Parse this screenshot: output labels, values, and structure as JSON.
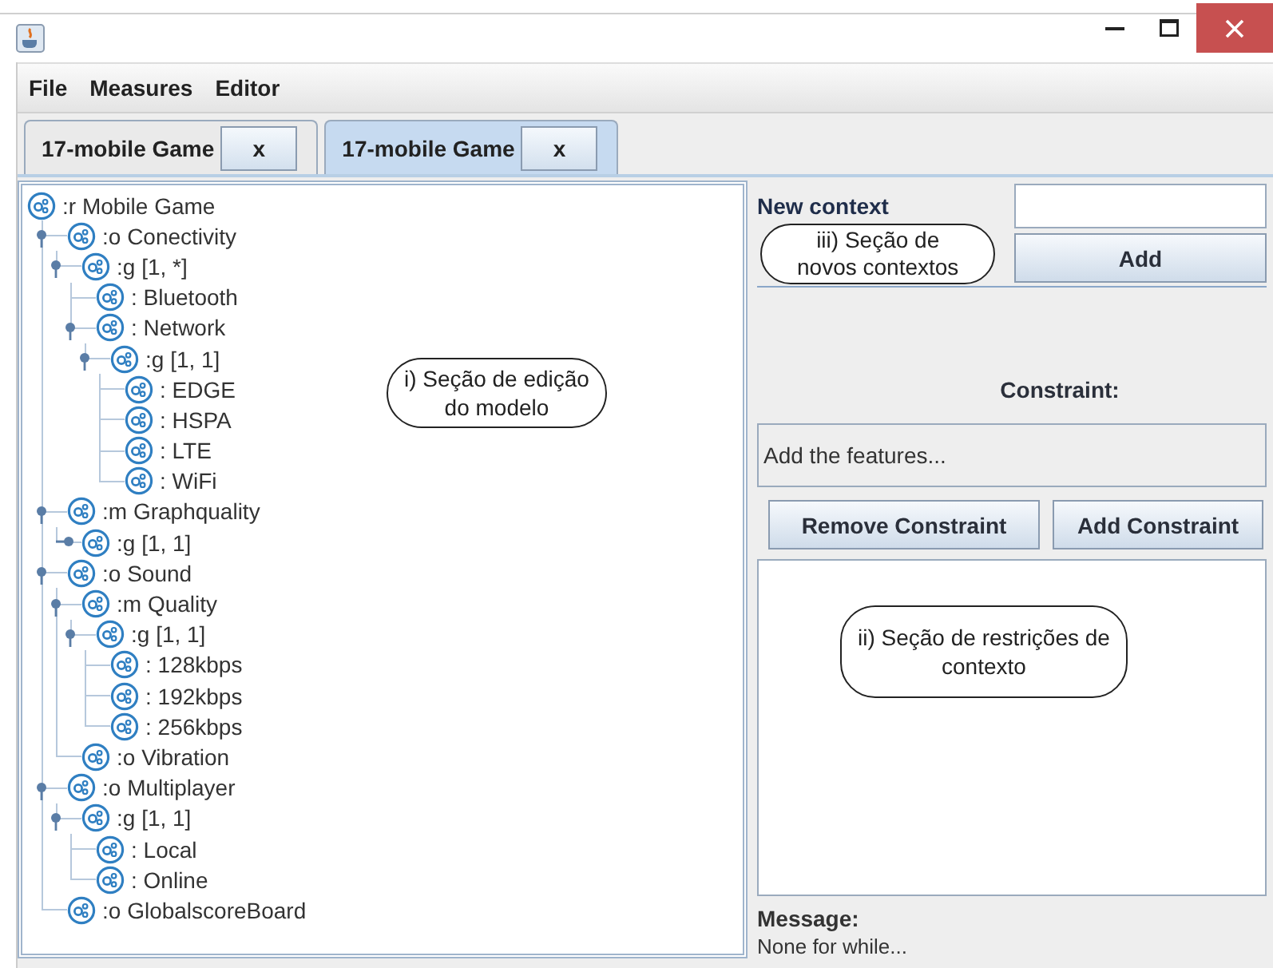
{
  "menu": [
    "File",
    "Measures",
    "Editor"
  ],
  "tabs": [
    {
      "label": "17-mobile Game",
      "close": "x",
      "selected": false
    },
    {
      "label": "17-mobile Game",
      "close": "x",
      "selected": true
    }
  ],
  "tree": {
    "label": ":r Mobile Game",
    "children": [
      {
        "label": ":o Conectivity",
        "expanded": true,
        "children": [
          {
            "label": ":g [1, *]",
            "expanded": true,
            "children": [
              {
                "label": ": Bluetooth"
              },
              {
                "label": ": Network",
                "expanded": true,
                "children": [
                  {
                    "label": ":g [1, 1]",
                    "expanded": true,
                    "children": [
                      {
                        "label": ": EDGE"
                      },
                      {
                        "label": ": HSPA"
                      },
                      {
                        "label": ": LTE"
                      },
                      {
                        "label": ": WiFi"
                      }
                    ]
                  }
                ]
              }
            ]
          }
        ]
      },
      {
        "label": ":m Graphquality",
        "expanded": true,
        "children": [
          {
            "label": ":g [1, 1]",
            "expanded": false
          }
        ]
      },
      {
        "label": ":o Sound",
        "expanded": true,
        "children": [
          {
            "label": ":m Quality",
            "expanded": true,
            "children": [
              {
                "label": ":g [1, 1]",
                "expanded": true,
                "children": [
                  {
                    "label": ": 128kbps"
                  },
                  {
                    "label": ": 192kbps"
                  },
                  {
                    "label": ": 256kbps"
                  }
                ]
              }
            ]
          },
          {
            "label": ":o Vibration"
          }
        ]
      },
      {
        "label": ":o Multiplayer",
        "expanded": true,
        "children": [
          {
            "label": ":g [1, 1]",
            "expanded": true,
            "children": [
              {
                "label": ": Local"
              },
              {
                "label": ": Online"
              }
            ]
          }
        ]
      },
      {
        "label": ":o GlobalscoreBoard"
      }
    ]
  },
  "tree_callout": [
    "i) Seção de edição",
    "do modelo"
  ],
  "context": {
    "label": "New context",
    "button": "Add",
    "callout": [
      "iii) Seção de",
      "novos contextos"
    ]
  },
  "constraint": {
    "label": "Constraint:",
    "value": "Add the features...",
    "buttons": [
      "Remove Constraint",
      "Add Constraint"
    ],
    "callout": [
      "ii) Seção de restrições de",
      "contexto"
    ]
  },
  "message": {
    "label": "Message:",
    "text": "None for while..."
  }
}
